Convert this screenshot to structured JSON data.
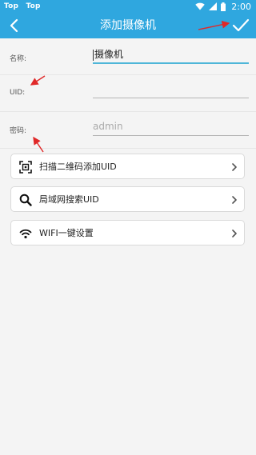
{
  "status_bar": {
    "left_items": [
      "Top",
      "Top"
    ],
    "time": "2:00",
    "icons": [
      "wifi-icon",
      "signal-icon",
      "battery-icon"
    ]
  },
  "header": {
    "title": "添加摄像机",
    "back_icon": "chevron-left-icon",
    "confirm_icon": "checkmark-icon"
  },
  "form": {
    "name": {
      "label": "名称:",
      "value": "摄像机"
    },
    "uid": {
      "label": "UID:",
      "value": ""
    },
    "password": {
      "label": "密码:",
      "placeholder": "admin"
    }
  },
  "actions": [
    {
      "label": "扫描二维码添加UID",
      "icon": "qr-scan-icon"
    },
    {
      "label": "局域网搜索UID",
      "icon": "search-icon"
    },
    {
      "label": "WIFI一键设置",
      "icon": "wifi-icon"
    }
  ],
  "colors": {
    "primary": "#2fa7df",
    "background": "#f4f4f4",
    "annotation_arrow": "#e02828",
    "focus_underline": "#4fb6d8"
  }
}
